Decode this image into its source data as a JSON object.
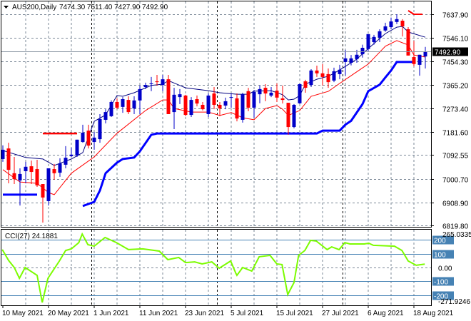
{
  "header": {
    "symbol": "AUS200,Daily",
    "ohlc": "7474.30 7511.40 7427.90 7492.90"
  },
  "colors": {
    "bull": "#0000c8",
    "bear": "#ff0000",
    "mid_line": "#000080",
    "lower_band": "#0000ff",
    "upper_band": "#ff0000",
    "red_line": "#ff0000",
    "cci": "#7cfc00",
    "cci_levels": "#4682b4",
    "grid": "#7a8796"
  },
  "chart_data": [
    {
      "type": "candlestick",
      "title": "AUS200,Daily",
      "ylim": [
        6819.8,
        7637.9
      ],
      "y_ticks": [
        "7637.90",
        "7546.10",
        "7454.30",
        "7365.20",
        "7273.40",
        "7181.60",
        "7092.55",
        "7000.70",
        "6908.90",
        "6819.80"
      ],
      "y_tick_values": [
        7637.9,
        7546.1,
        7454.3,
        7365.2,
        7273.4,
        7181.6,
        7092.55,
        7000.7,
        6908.9,
        6819.8
      ],
      "current_price": "7492.90",
      "current_price_value": 7492.9,
      "x_labels": [
        {
          "label": "10 May 2021",
          "index": 0
        },
        {
          "label": "20 May 2021",
          "index": 8
        },
        {
          "label": "1 Jun 2021",
          "index": 16
        },
        {
          "label": "11 Jun 2021",
          "index": 24
        },
        {
          "label": "23 Jun 2021",
          "index": 32
        },
        {
          "label": "5 Jul 2021",
          "index": 40
        },
        {
          "label": "15 Jul 2021",
          "index": 48
        },
        {
          "label": "27 Jul 2021",
          "index": 56
        },
        {
          "label": "6 Aug 2021",
          "index": 64
        },
        {
          "label": "18 Aug 2021",
          "index": 72
        }
      ],
      "month_separators": [
        16,
        38,
        60
      ],
      "ohlc": [
        [
          7077,
          7130,
          7066,
          7113
        ],
        [
          7118,
          7140,
          6983,
          7035
        ],
        [
          7022,
          7085,
          6980,
          6999
        ],
        [
          6994,
          7041,
          6897,
          7019
        ],
        [
          7030,
          7066,
          6983,
          7047
        ],
        [
          7049,
          7071,
          6980,
          7027
        ],
        [
          7038,
          7074,
          6969,
          6975
        ],
        [
          6980,
          6980,
          6831,
          6928
        ],
        [
          6914,
          7041,
          6897,
          7041
        ],
        [
          7038,
          7058,
          6997,
          7022
        ],
        [
          7024,
          7080,
          7008,
          7060
        ],
        [
          7055,
          7127,
          7041,
          7082
        ],
        [
          7088,
          7121,
          7085,
          7094
        ],
        [
          7091,
          7152,
          7085,
          7152
        ],
        [
          7143,
          7210,
          7140,
          7179
        ],
        [
          7187,
          7210,
          7118,
          7129
        ],
        [
          7143,
          7182,
          7113,
          7160
        ],
        [
          7154,
          7251,
          7140,
          7232
        ],
        [
          7229,
          7270,
          7215,
          7259
        ],
        [
          7243,
          7304,
          7240,
          7298
        ],
        [
          7298,
          7312,
          7270,
          7276
        ],
        [
          7279,
          7317,
          7256,
          7309
        ],
        [
          7306,
          7320,
          7251,
          7259
        ],
        [
          7273,
          7320,
          7251,
          7304
        ],
        [
          7304,
          7362,
          7251,
          7348
        ],
        [
          7356,
          7373,
          7348,
          7364
        ],
        [
          7367,
          7395,
          7340,
          7370
        ],
        [
          7378,
          7403,
          7362,
          7375
        ],
        [
          7364,
          7403,
          7340,
          7386
        ],
        [
          7386,
          7403,
          7251,
          7251
        ],
        [
          7259,
          7353,
          7193,
          7326
        ],
        [
          7317,
          7348,
          7290,
          7328
        ],
        [
          7323,
          7326,
          7243,
          7248
        ],
        [
          7248,
          7317,
          7240,
          7306
        ],
        [
          7309,
          7323,
          7281,
          7292
        ],
        [
          7287,
          7298,
          7265,
          7270
        ],
        [
          7251,
          7331,
          7240,
          7323
        ],
        [
          7331,
          7356,
          7270,
          7287
        ],
        [
          7287,
          7298,
          7243,
          7273
        ],
        [
          7284,
          7315,
          7270,
          7301
        ],
        [
          7315,
          7331,
          7276,
          7317
        ],
        [
          7312,
          7331,
          7223,
          7234
        ],
        [
          7229,
          7334,
          7218,
          7328
        ],
        [
          7340,
          7353,
          7262,
          7276
        ],
        [
          7276,
          7345,
          7237,
          7337
        ],
        [
          7328,
          7362,
          7293,
          7348
        ],
        [
          7353,
          7367,
          7301,
          7331
        ],
        [
          7323,
          7356,
          7317,
          7334
        ],
        [
          7342,
          7370,
          7298,
          7315
        ],
        [
          7312,
          7362,
          7292,
          7306
        ],
        [
          7295,
          7295,
          7171,
          7201
        ],
        [
          7201,
          7290,
          7196,
          7287
        ],
        [
          7293,
          7370,
          7290,
          7367
        ],
        [
          7378,
          7384,
          7334,
          7353
        ],
        [
          7364,
          7425,
          7356,
          7420
        ],
        [
          7420,
          7439,
          7395,
          7409
        ],
        [
          7409,
          7445,
          7362,
          7395
        ],
        [
          7406,
          7428,
          7353,
          7375
        ],
        [
          7381,
          7431,
          7375,
          7417
        ],
        [
          7406,
          7442,
          7386,
          7423
        ],
        [
          7453,
          7500,
          7400,
          7467
        ],
        [
          7450,
          7480,
          7440,
          7467
        ],
        [
          7464,
          7500,
          7450,
          7481
        ],
        [
          7483,
          7520,
          7470,
          7508
        ],
        [
          7503,
          7561,
          7495,
          7561
        ],
        [
          7530,
          7558,
          7520,
          7550
        ],
        [
          7547,
          7580,
          7530,
          7572
        ],
        [
          7575,
          7605,
          7570,
          7591
        ],
        [
          7588,
          7625,
          7580,
          7610
        ],
        [
          7608,
          7638,
          7600,
          7619
        ],
        [
          7613,
          7619,
          7552,
          7591
        ],
        [
          7580,
          7588,
          7478,
          7478
        ],
        [
          7472,
          7535,
          7436,
          7445
        ],
        [
          7442,
          7481,
          7400,
          7481
        ],
        [
          7474.3,
          7511.4,
          7427.9,
          7492.9
        ]
      ],
      "series": [
        {
          "name": "mid_line",
          "points": [
            [
              0,
              7110
            ],
            [
              4,
              7083
            ],
            [
              7,
              7077
            ],
            [
              9,
              7052
            ],
            [
              12,
              7077
            ],
            [
              14,
              7102
            ],
            [
              16,
              7223
            ],
            [
              18,
              7248
            ],
            [
              20,
              7323
            ],
            [
              21,
              7320
            ],
            [
              23,
              7334
            ],
            [
              26,
              7362
            ],
            [
              28,
              7367
            ],
            [
              29,
              7381
            ],
            [
              32,
              7353
            ],
            [
              36,
              7342
            ],
            [
              38,
              7334
            ],
            [
              41,
              7328
            ],
            [
              43,
              7328
            ],
            [
              44,
              7340
            ],
            [
              47,
              7342
            ],
            [
              49,
              7326
            ],
            [
              50,
              7306
            ],
            [
              51,
              7309
            ],
            [
              52,
              7323
            ],
            [
              53,
              7367
            ],
            [
              55,
              7386
            ],
            [
              57,
              7398
            ],
            [
              58,
              7409
            ],
            [
              60,
              7436
            ],
            [
              62,
              7464
            ],
            [
              64,
              7505
            ],
            [
              67,
              7563
            ],
            [
              69,
              7588
            ],
            [
              70,
              7591
            ],
            [
              71,
              7569
            ],
            [
              74,
              7549
            ]
          ]
        },
        {
          "name": "red_line",
          "points": [
            [
              0,
              7036
            ],
            [
              3,
              6988
            ],
            [
              6,
              6983
            ],
            [
              8,
              6947
            ],
            [
              9,
              6939
            ],
            [
              12,
              7022
            ],
            [
              16,
              7085
            ],
            [
              20,
              7177
            ],
            [
              25,
              7265
            ],
            [
              28,
              7306
            ],
            [
              29,
              7306
            ],
            [
              30,
              7273
            ],
            [
              33,
              7259
            ],
            [
              36,
              7259
            ],
            [
              38,
              7246
            ],
            [
              40,
              7257
            ],
            [
              42,
              7237
            ],
            [
              44,
              7229
            ],
            [
              46,
              7273
            ],
            [
              48,
              7284
            ],
            [
              49,
              7270
            ],
            [
              50,
              7246
            ],
            [
              52,
              7265
            ],
            [
              54,
              7320
            ],
            [
              57,
              7339
            ],
            [
              59,
              7370
            ],
            [
              61,
              7400
            ],
            [
              63,
              7430
            ],
            [
              64,
              7445
            ],
            [
              67,
              7514
            ],
            [
              69,
              7536
            ],
            [
              71,
              7519
            ],
            [
              72,
              7480
            ],
            [
              74,
              7472
            ]
          ]
        },
        {
          "name": "lower_band_left",
          "points": [
            [
              0,
              6939
            ],
            [
              6,
              6939
            ]
          ]
        },
        {
          "name": "lower_band",
          "points": [
            [
              14,
              6895
            ],
            [
              16,
              6911
            ],
            [
              17,
              6955
            ],
            [
              18,
              7022
            ],
            [
              20,
              7063
            ],
            [
              21,
              7077
            ],
            [
              23,
              7083
            ],
            [
              24,
              7107
            ],
            [
              26,
              7171
            ],
            [
              27,
              7176
            ],
            [
              55,
              7176
            ],
            [
              56,
              7187
            ],
            [
              59,
              7187
            ],
            [
              60,
              7210
            ],
            [
              61,
              7225
            ],
            [
              63,
              7290
            ],
            [
              64,
              7340
            ],
            [
              66,
              7365
            ],
            [
              67,
              7393
            ],
            [
              68,
              7420
            ],
            [
              69,
              7453
            ],
            [
              72,
              7453
            ]
          ]
        },
        {
          "name": "upper_band_left",
          "points": [
            [
              7,
              7176
            ],
            [
              13,
              7176
            ]
          ]
        },
        {
          "name": "upper_band_right",
          "points": [
            [
              71,
              7652
            ],
            [
              72,
              7638
            ],
            [
              73.5,
              7638
            ]
          ]
        }
      ]
    },
    {
      "type": "line",
      "title": "CCI(27) 24.1881",
      "ylim": [
        -271.9246,
        265.0335
      ],
      "y_top_label": "265.0335",
      "y_bottom_label": "-271.9246",
      "levels": [
        {
          "label": "200",
          "value": 200,
          "boxed": true
        },
        {
          "label": "100",
          "value": 100,
          "boxed": true
        },
        {
          "label": "0.00",
          "value": 0,
          "boxed": false
        },
        {
          "label": "-100",
          "value": -100,
          "boxed": true
        },
        {
          "label": "-200",
          "value": -200,
          "boxed": true
        }
      ],
      "points": [
        [
          -0.1,
          130
        ],
        [
          1,
          52
        ],
        [
          2,
          0
        ],
        [
          2.9,
          -78
        ],
        [
          3.9,
          0
        ],
        [
          6,
          -57
        ],
        [
          6.9,
          -254
        ],
        [
          7.9,
          -78
        ],
        [
          9.9,
          47
        ],
        [
          11,
          124
        ],
        [
          12,
          135
        ],
        [
          13.3,
          181
        ],
        [
          13.9,
          243
        ],
        [
          14.9,
          166
        ],
        [
          16,
          155
        ],
        [
          17.9,
          218
        ],
        [
          19.9,
          181
        ],
        [
          22,
          130
        ],
        [
          24.5,
          135
        ],
        [
          27.4,
          119
        ],
        [
          28.9,
          57
        ],
        [
          30.8,
          73
        ],
        [
          32,
          36
        ],
        [
          33.6,
          41
        ],
        [
          34.9,
          26
        ],
        [
          36.6,
          41
        ],
        [
          37.9,
          -5
        ],
        [
          39.9,
          47
        ],
        [
          40.8,
          -41
        ],
        [
          41,
          -57
        ],
        [
          42,
          0
        ],
        [
          43.6,
          -26
        ],
        [
          44.9,
          78
        ],
        [
          46.8,
          88
        ],
        [
          48,
          26
        ],
        [
          48.9,
          21
        ],
        [
          49.9,
          -197
        ],
        [
          51,
          -109
        ],
        [
          51.8,
          88
        ],
        [
          52.9,
          124
        ],
        [
          53.9,
          197
        ],
        [
          54.9,
          192
        ],
        [
          56.8,
          130
        ],
        [
          57.6,
          150
        ],
        [
          58.9,
          130
        ],
        [
          59.9,
          181
        ],
        [
          60.8,
          171
        ],
        [
          63.3,
          171
        ],
        [
          64.1,
          176
        ],
        [
          64.9,
          161
        ],
        [
          68.6,
          155
        ],
        [
          69.9,
          124
        ],
        [
          71,
          47
        ],
        [
          72.4,
          16
        ],
        [
          73.9,
          24.19
        ]
      ]
    }
  ]
}
